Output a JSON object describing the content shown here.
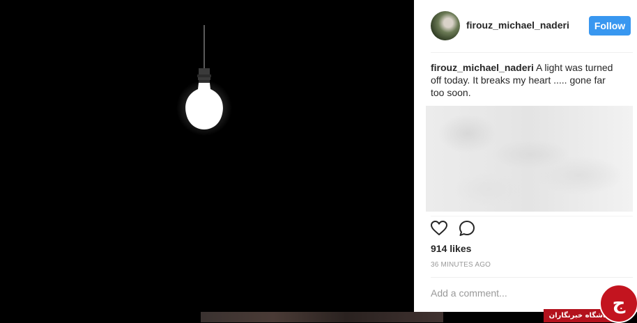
{
  "post": {
    "username": "firouz_michael_naderi",
    "follow_label": "Follow",
    "caption_user": "firouz_michael_naderi",
    "caption_text": "A light was turned off today. It breaks my heart ..... gone far too soon.",
    "likes": "914 likes",
    "timestamp": "36 MINUTES AGO",
    "comment_placeholder": "Add a comment..."
  },
  "icons": {
    "like": "heart-icon",
    "comment": "comment-bubble-icon",
    "photo_subject": "light-bulb"
  },
  "badge": {
    "label": "باشگاه خبرنگاران",
    "logo_glyph": "ج"
  },
  "colors": {
    "follow_button": "#3897f0",
    "photo_background": "#000000",
    "badge_red": "#c3141f"
  }
}
